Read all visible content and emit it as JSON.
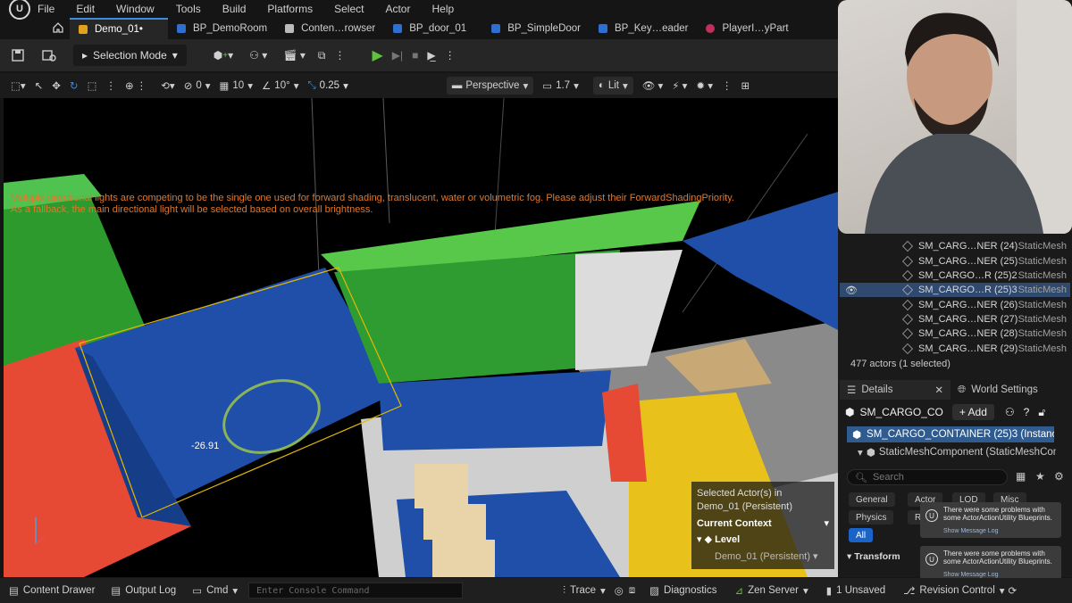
{
  "menu": [
    "File",
    "Edit",
    "Window",
    "Tools",
    "Build",
    "Platforms",
    "Select",
    "Actor",
    "Help"
  ],
  "tabs": [
    {
      "label": "Demo_01•",
      "color": "#e3a21a"
    },
    {
      "label": "BP_DemoRoom",
      "color": "#2f6fd1"
    },
    {
      "label": "Conten…rowser",
      "color": "#bbbbbb"
    },
    {
      "label": "BP_door_01",
      "color": "#2f6fd1"
    },
    {
      "label": "BP_SimpleDoor",
      "color": "#2f6fd1"
    },
    {
      "label": "BP_Key…eader",
      "color": "#2f6fd1"
    },
    {
      "label": "PlayerI…yPart",
      "color": "#c0305a"
    }
  ],
  "toolbar": {
    "selection_mode": "Selection Mode"
  },
  "viewport_toolbar": {
    "rotate_snap": "0",
    "grid": "10",
    "angle": "10°",
    "scale": "0.25",
    "perspective": "Perspective",
    "speed": "1.7",
    "lit": "Lit"
  },
  "viewport": {
    "warning_line1": "Multiple directional lights are competing to be the single one used for forward shading, translucent, water or volumetric fog. Please adjust their ForwardShadingPriority.",
    "warning_line2": "As a fallback, the main directional light will be selected based on overall brightness.",
    "rotation_readout": "-26.91",
    "selected_title": "Selected Actor(s) in",
    "selected_level": "Demo_01 (Persistent)",
    "current_context": "Current Context",
    "level_label": "Level",
    "level_value": "Demo_01 (Persistent)"
  },
  "outliner": {
    "rows": [
      {
        "name": "SM_CARG…NER (24)",
        "type": "StaticMesh",
        "selected": false
      },
      {
        "name": "SM_CARG…NER (25)",
        "type": "StaticMesh",
        "selected": false
      },
      {
        "name": "SM_CARGO…R (25)2",
        "type": "StaticMesh",
        "selected": false
      },
      {
        "name": "SM_CARGO…R (25)3",
        "type": "StaticMesh",
        "selected": true
      },
      {
        "name": "SM_CARG…NER (26)",
        "type": "StaticMesh",
        "selected": false
      },
      {
        "name": "SM_CARG…NER (27)",
        "type": "StaticMesh",
        "selected": false
      },
      {
        "name": "SM_CARG…NER (28)",
        "type": "StaticMesh",
        "selected": false
      },
      {
        "name": "SM_CARG…NER (29)",
        "type": "StaticMesh",
        "selected": false
      }
    ],
    "count": "477 actors (1 selected)"
  },
  "details": {
    "tab_details": "Details",
    "tab_world": "World Settings",
    "actor_name": "SM_CARGO_CO",
    "add_label": "+ Add",
    "instance": "SM_CARGO_CONTAINER (25)3 (Instance)",
    "component": "StaticMeshComponent (StaticMeshCom",
    "search_placeholder": "Search",
    "filters": [
      "General",
      "Actor",
      "LOD",
      "Misc",
      "Physics",
      "R",
      "All"
    ],
    "transform": "Transform"
  },
  "toasts": [
    {
      "text": "There were some problems with some ActorActionUtility Blueprints.",
      "link": "Show Message Log"
    },
    {
      "text": "There were some problems with some ActorActionUtility Blueprints.",
      "link": "Show Message Log"
    }
  ],
  "status": {
    "content_drawer": "Content Drawer",
    "output_log": "Output Log",
    "cmd": "Cmd",
    "console_placeholder": "Enter Console Command",
    "trace": "Trace",
    "diagnostics": "Diagnostics",
    "zen": "Zen Server",
    "unsaved": "1 Unsaved",
    "revision": "Revision Control"
  },
  "colors": {
    "accent": "#3a8de0",
    "selection": "#2f5b8f",
    "warning": "#e0782a"
  }
}
